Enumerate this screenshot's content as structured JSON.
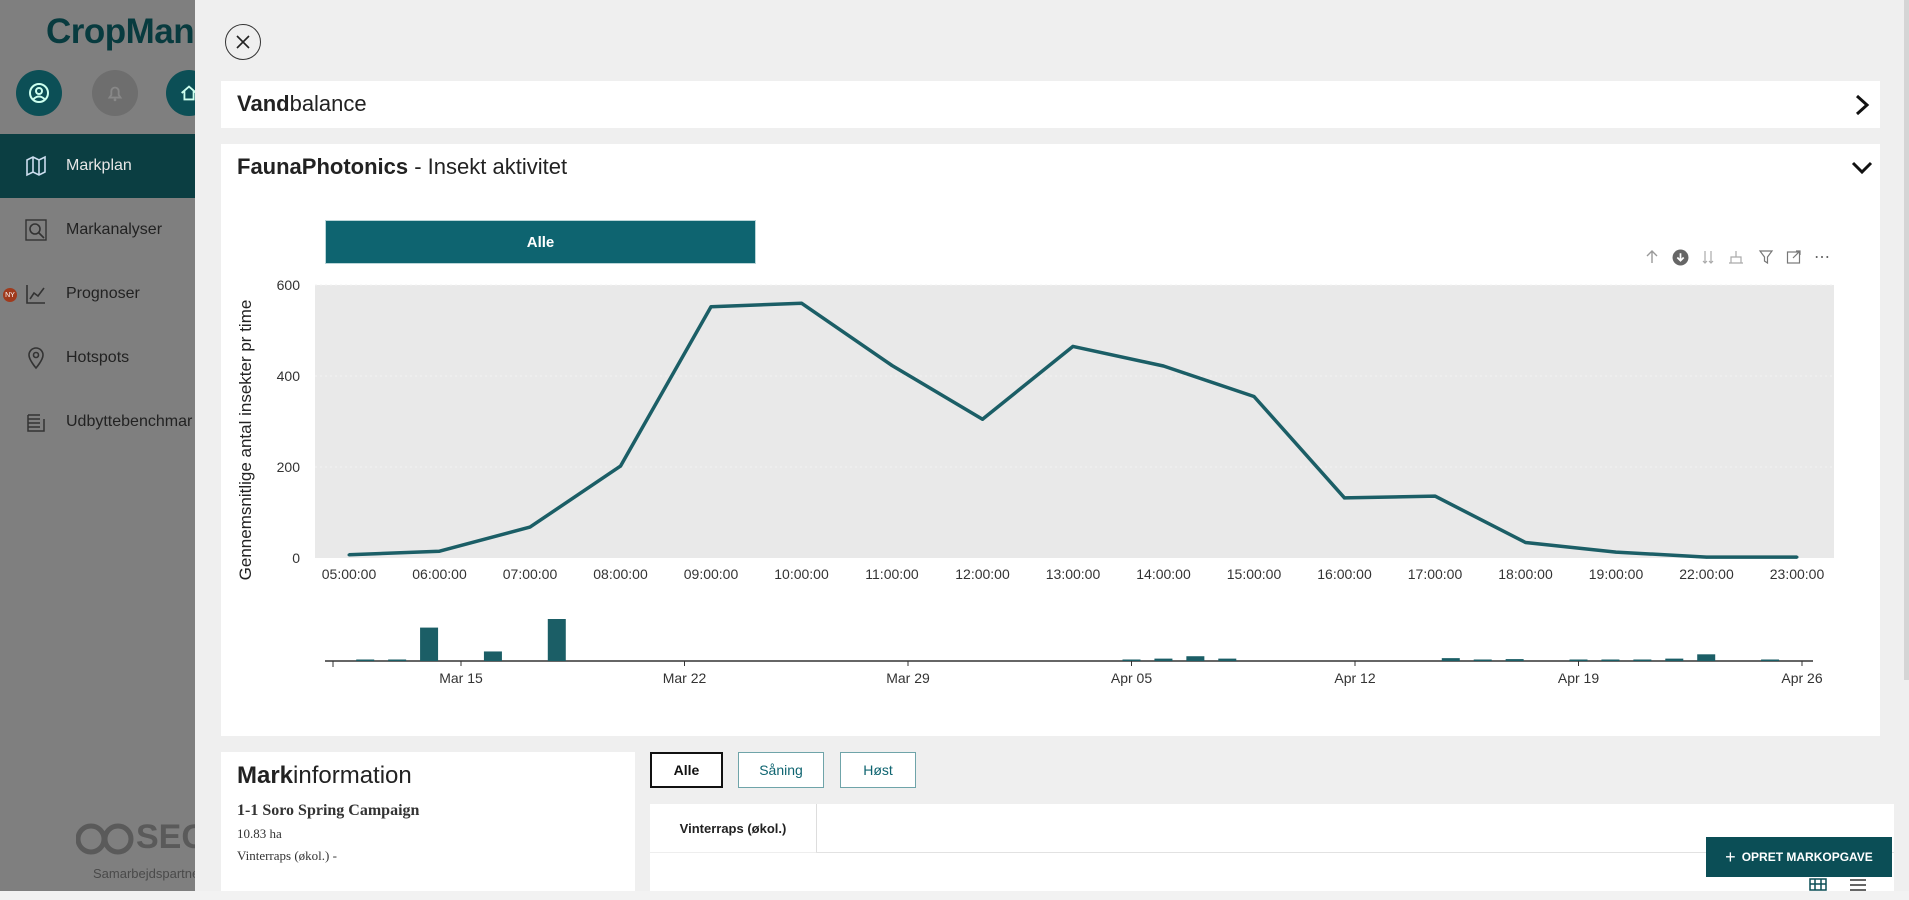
{
  "background_app": {
    "logo": "CropMana",
    "nav": [
      {
        "label": "Markplan",
        "icon": "map-icon",
        "active": true
      },
      {
        "label": "Markanalyser",
        "icon": "magnifier-icon"
      },
      {
        "label": "Prognoser",
        "icon": "chart-icon",
        "badge": "NY"
      },
      {
        "label": "Hotspots",
        "icon": "location-pin-icon"
      },
      {
        "label": "Udbyttebenchmar",
        "icon": "stack-icon"
      }
    ],
    "partner_logo": "SEGE",
    "partner_label": "Samarbejdspartne"
  },
  "vandbalance": {
    "title_bold": "Vand",
    "title_rest": "balance"
  },
  "insect_section": {
    "title_bold": "FaunaPhotonics",
    "title_rest": " - Insekt aktivitet",
    "tab_label": "Alle"
  },
  "chart_data": [
    {
      "type": "line",
      "ylabel": "Gennemsnitlige antal insekter pr time",
      "ylim": [
        0,
        600
      ],
      "yticks": [
        0,
        200,
        400,
        600
      ],
      "x": [
        "05:00:00",
        "06:00:00",
        "07:00:00",
        "08:00:00",
        "09:00:00",
        "10:00:00",
        "11:00:00",
        "12:00:00",
        "13:00:00",
        "14:00:00",
        "15:00:00",
        "16:00:00",
        "17:00:00",
        "18:00:00",
        "19:00:00",
        "22:00:00",
        "23:00:00"
      ],
      "series": [
        {
          "values": [
            7,
            15,
            68,
            202,
            552,
            560,
            423,
            305,
            465,
            422,
            355,
            132,
            136,
            34,
            13,
            2,
            2
          ]
        }
      ],
      "color": "#1b5e66",
      "plot_background": "#e9e9e9",
      "grid": true
    },
    {
      "type": "bar",
      "x_ticks": [
        "Mar 15",
        "Mar 22",
        "Mar 29",
        "Apr 05",
        "Apr 12",
        "Apr 19",
        "Apr 26"
      ],
      "bars": [
        {
          "date": "2024-03-12",
          "value": 3
        },
        {
          "date": "2024-03-13",
          "value": 3
        },
        {
          "date": "2024-03-14",
          "value": 70
        },
        {
          "date": "2024-03-16",
          "value": 20
        },
        {
          "date": "2024-03-18",
          "value": 88
        },
        {
          "date": "2024-04-05",
          "value": 2
        },
        {
          "date": "2024-04-06",
          "value": 5
        },
        {
          "date": "2024-04-07",
          "value": 10
        },
        {
          "date": "2024-04-08",
          "value": 5
        },
        {
          "date": "2024-04-15",
          "value": 6
        },
        {
          "date": "2024-04-16",
          "value": 3
        },
        {
          "date": "2024-04-17",
          "value": 4
        },
        {
          "date": "2024-04-19",
          "value": 3
        },
        {
          "date": "2024-04-20",
          "value": 3
        },
        {
          "date": "2024-04-21",
          "value": 3
        },
        {
          "date": "2024-04-22",
          "value": 5
        },
        {
          "date": "2024-04-23",
          "value": 14
        },
        {
          "date": "2024-04-25",
          "value": 3
        }
      ],
      "color": "#1b5e66"
    }
  ],
  "toolbar": {
    "icons": [
      "arrow-up-icon",
      "download-icon",
      "sort-icon",
      "hierarchy-icon",
      "filter-icon",
      "focus-mode-icon",
      "more-options-icon"
    ],
    "more_label": "⋯"
  },
  "markinformation": {
    "title_bold": "Mark",
    "title_rest": "information",
    "field_name": "1-1 Soro Spring Campaign",
    "area": "10.83 ha",
    "crop": "Vinterraps (økol.) -"
  },
  "filters": {
    "all": "Alle",
    "saaning": "Såning",
    "hoest": "Høst"
  },
  "crop_tab": "Vinterraps (økol.)",
  "opret_button": "OPRET MARKOPGAVE",
  "opret_icon": "+"
}
